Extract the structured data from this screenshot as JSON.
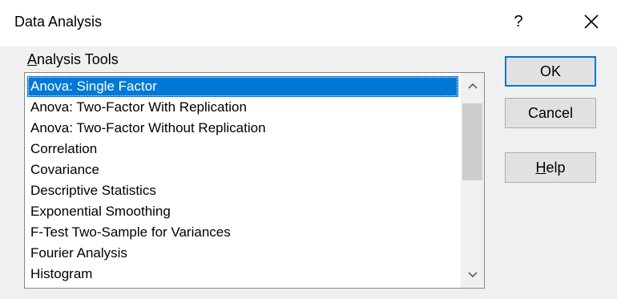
{
  "window": {
    "title": "Data Analysis",
    "help_glyph": "?",
    "close_icon": "close-icon"
  },
  "analysis_tools": {
    "label_mnemonic": "A",
    "label_rest": "nalysis Tools",
    "selected_index": 0,
    "items": [
      "Anova: Single Factor",
      "Anova: Two-Factor With Replication",
      "Anova: Two-Factor Without Replication",
      "Correlation",
      "Covariance",
      "Descriptive Statistics",
      "Exponential Smoothing",
      "F-Test Two-Sample for Variances",
      "Fourier Analysis",
      "Histogram"
    ]
  },
  "buttons": {
    "ok_label": "OK",
    "cancel_label": "Cancel",
    "help_mnemonic": "H",
    "help_rest": "elp"
  },
  "colors": {
    "selection": "#0078d7",
    "dialog_background": "#f0f0f0",
    "title_background": "#ffffff",
    "scrollbar_thumb": "#cdcdcd"
  }
}
